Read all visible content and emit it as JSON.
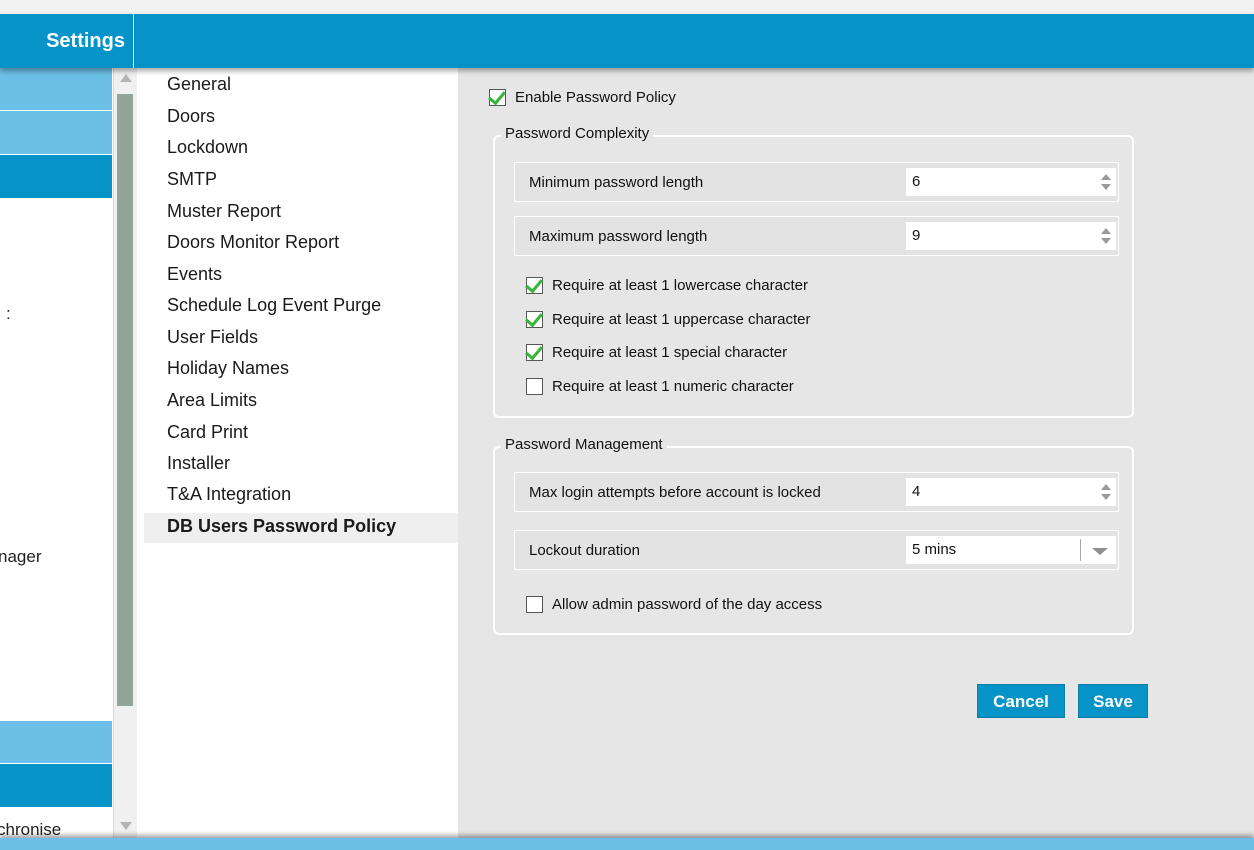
{
  "header": {
    "title": "Settings"
  },
  "left_nav": {
    "items": [
      {
        "label": ""
      },
      {
        "label": ""
      },
      {
        "label": ""
      },
      {
        "label": ":"
      },
      {
        "label": "nager"
      },
      {
        "label": ""
      },
      {
        "label": ""
      },
      {
        "label": "chronise"
      }
    ]
  },
  "categories": [
    {
      "label": "General"
    },
    {
      "label": "Doors"
    },
    {
      "label": "Lockdown"
    },
    {
      "label": "SMTP"
    },
    {
      "label": "Muster Report"
    },
    {
      "label": "Doors Monitor Report"
    },
    {
      "label": "Events"
    },
    {
      "label": "Schedule Log Event Purge"
    },
    {
      "label": "User Fields"
    },
    {
      "label": "Holiday Names"
    },
    {
      "label": "Area Limits"
    },
    {
      "label": "Card Print"
    },
    {
      "label": "Installer"
    },
    {
      "label": "T&A Integration"
    },
    {
      "label": "DB Users Password Policy",
      "selected": true
    }
  ],
  "policy": {
    "enable_label": "Enable Password Policy",
    "enable_checked": true,
    "complexity": {
      "title": "Password Complexity",
      "min_length_label": "Minimum password length",
      "min_length_value": "6",
      "max_length_label": "Maximum password length",
      "max_length_value": "9",
      "requirements": [
        {
          "label": "Require at least 1 lowercase character",
          "checked": true
        },
        {
          "label": "Require at least 1 uppercase character",
          "checked": true
        },
        {
          "label": "Require at least 1 special character",
          "checked": true
        },
        {
          "label": "Require at least 1 numeric character",
          "checked": false
        }
      ]
    },
    "management": {
      "title": "Password Management",
      "max_attempts_label": "Max login attempts before account is locked",
      "max_attempts_value": "4",
      "lockout_label": "Lockout duration",
      "lockout_value": "5 mins",
      "admin_pod_label": "Allow admin password of the day access",
      "admin_pod_checked": false
    }
  },
  "buttons": {
    "cancel": "Cancel",
    "save": "Save"
  },
  "colors": {
    "accent": "#0593c8",
    "accent_light": "#6cbfe6",
    "check": "#35b535",
    "panel": "#e6e6e6"
  }
}
